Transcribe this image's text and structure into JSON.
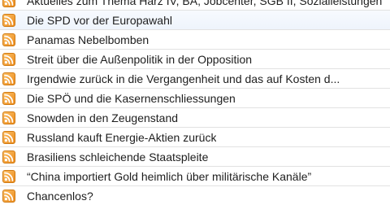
{
  "feed_list": {
    "icon": "rss-feed-icon",
    "icon_colors": {
      "outer": "#e08a1c",
      "fill": "#f9a73b",
      "glyph": "#ffffff"
    },
    "items": [
      {
        "title": "Aktuelles zum Thema Harz IV, BA, Jobcenter, SGB II, Sozialleistungen"
      },
      {
        "title": "Die SPD vor der Europawahl"
      },
      {
        "title": "Panamas Nebelbomben"
      },
      {
        "title": "Streit über die Außenpolitik in der Opposition"
      },
      {
        "title": "Irgendwie zurück in die Vergangenheit und das auf Kosten d..."
      },
      {
        "title": "Die SPÖ und die Kasernenschliessungen"
      },
      {
        "title": "Snowden in den Zeugenstand"
      },
      {
        "title": "Russland kauft Energie-Aktien zurück"
      },
      {
        "title": "Brasiliens schleichende Staatspleite"
      },
      {
        "title": "“China importiert Gold heimlich über militärische Kanäle”"
      },
      {
        "title": "Chancenlos?"
      }
    ]
  }
}
